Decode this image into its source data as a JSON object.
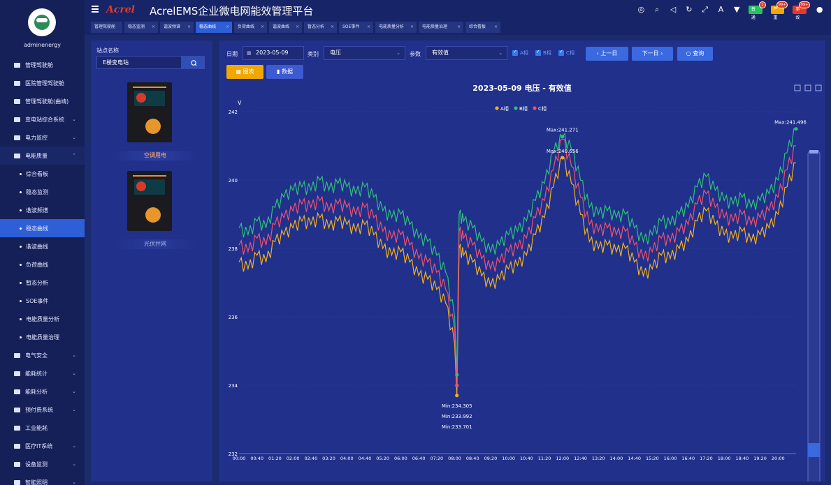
{
  "app": {
    "logo": "Acrel",
    "title": "AcrelEMS企业微电网能效管理平台"
  },
  "user": {
    "name": "adminenergy"
  },
  "topbar": {
    "icons": [
      "help-icon",
      "search-icon",
      "volume-icon",
      "refresh-icon",
      "fullscreen-icon",
      "font-icon",
      "shirt-icon"
    ],
    "badges": [
      {
        "label": "普通",
        "count": "2",
        "color": "#22c55e"
      },
      {
        "label": "严重",
        "count": "99+",
        "color": "#f0a800"
      },
      {
        "label": "事故",
        "count": "99+",
        "color": "#e23a2a"
      }
    ]
  },
  "menu": [
    {
      "label": "管理驾驶舱",
      "type": "item"
    },
    {
      "label": "医院管理驾驶舱",
      "type": "item"
    },
    {
      "label": "管理驾驶舱(曲靖)",
      "type": "item"
    },
    {
      "label": "变电站综合系统",
      "type": "item",
      "arrow": "⌄"
    },
    {
      "label": "电力监控",
      "type": "item",
      "arrow": "⌄"
    },
    {
      "label": "电能质量",
      "type": "group",
      "arrow": "⌃"
    },
    {
      "label": "综合看板",
      "type": "sub"
    },
    {
      "label": "稳态监测",
      "type": "sub"
    },
    {
      "label": "谐波频谱",
      "type": "sub"
    },
    {
      "label": "稳态曲线",
      "type": "sub",
      "active": true
    },
    {
      "label": "谐波曲线",
      "type": "sub"
    },
    {
      "label": "负荷曲线",
      "type": "sub"
    },
    {
      "label": "暂态分析",
      "type": "sub"
    },
    {
      "label": "SOE事件",
      "type": "sub"
    },
    {
      "label": "电能质量分析",
      "type": "sub"
    },
    {
      "label": "电能质量治理",
      "type": "sub"
    },
    {
      "label": "电气安全",
      "type": "item",
      "arrow": "⌄"
    },
    {
      "label": "能耗统计",
      "type": "item",
      "arrow": "⌄"
    },
    {
      "label": "能耗分析",
      "type": "item",
      "arrow": "⌄"
    },
    {
      "label": "预付费系统",
      "type": "item",
      "arrow": "⌄"
    },
    {
      "label": "工业能耗",
      "type": "item"
    },
    {
      "label": "医疗IT系统",
      "type": "item",
      "arrow": "⌄"
    },
    {
      "label": "设备监测",
      "type": "item",
      "arrow": "⌄"
    },
    {
      "label": "智能照明",
      "type": "item",
      "arrow": "⌄"
    }
  ],
  "tabs": [
    {
      "label": "管理驾驶舱",
      "closable": false
    },
    {
      "label": "稳态监测",
      "closable": true
    },
    {
      "label": "谐波频谱",
      "closable": true
    },
    {
      "label": "稳态曲线",
      "closable": true,
      "active": true
    },
    {
      "label": "负荷曲线",
      "closable": true
    },
    {
      "label": "谐波曲线",
      "closable": true
    },
    {
      "label": "暂态分析",
      "closable": true
    },
    {
      "label": "SOE事件",
      "closable": true
    },
    {
      "label": "电能质量分析",
      "closable": true
    },
    {
      "label": "电能质量治理",
      "closable": true
    },
    {
      "label": "综合看板",
      "closable": true
    }
  ],
  "station": {
    "label": "站点名称",
    "value": "E楼变电站",
    "devices": [
      {
        "name": "空调用电",
        "selected": true
      },
      {
        "name": "光伏并网",
        "selected": false
      }
    ]
  },
  "filters": {
    "date_label": "日期",
    "date_value": "2023-05-09",
    "category_label": "类别",
    "category_value": "电压",
    "param_label": "参数",
    "param_value": "有效值",
    "phases": [
      "A相",
      "B相",
      "C相"
    ],
    "prev": "上一日",
    "next": "下一日",
    "query": "查询",
    "view_chart": "图表",
    "view_data": "数据"
  },
  "chart_data": {
    "type": "line",
    "title": "2023-05-09  电压 - 有效值",
    "ylabel": "V",
    "ylim": [
      232,
      242
    ],
    "yticks": [
      232,
      234,
      236,
      238,
      240,
      242
    ],
    "xticks": [
      "00:00",
      "00:40",
      "01:20",
      "02:00",
      "02:40",
      "03:20",
      "04:00",
      "04:40",
      "05:20",
      "06:00",
      "06:40",
      "07:20",
      "08:00",
      "08:40",
      "09:20",
      "10:00",
      "10:40",
      "11:20",
      "12:00",
      "12:40",
      "13:20",
      "14:00",
      "14:40",
      "15:20",
      "16:00",
      "16:40",
      "17:20",
      "18:00",
      "18:40",
      "19:20",
      "20:00"
    ],
    "legend_position": "top-center",
    "series": [
      {
        "name": "A相",
        "color": "#f0b020",
        "x": [
          0,
          20,
          40,
          60,
          80,
          100,
          120,
          140,
          160,
          180,
          200,
          220,
          240,
          260,
          280,
          300,
          320,
          340,
          360,
          380,
          400,
          420,
          440,
          460,
          480,
          485,
          490,
          500,
          520,
          540,
          560,
          580,
          600,
          620,
          640,
          660,
          680,
          700,
          720,
          740,
          760,
          780,
          800,
          820,
          840,
          860,
          880,
          900,
          920,
          940,
          960,
          980,
          1000,
          1020,
          1040,
          1060,
          1080,
          1100,
          1120,
          1140,
          1160,
          1180,
          1200,
          1220,
          1240
        ],
        "values": [
          237.6,
          237.4,
          237.8,
          237.6,
          238.2,
          238.4,
          238.6,
          238.8,
          238.7,
          238.9,
          238.6,
          238.8,
          238.7,
          238.5,
          238.7,
          238.4,
          238.0,
          237.8,
          237.9,
          237.6,
          237.2,
          237.1,
          236.8,
          236.4,
          235.2,
          233.701,
          238.0,
          237.8,
          237.6,
          237.2,
          236.9,
          237.1,
          237.4,
          237.5,
          237.8,
          238.4,
          238.9,
          239.8,
          240.656,
          239.9,
          239.0,
          238.2,
          238.0,
          238.1,
          237.9,
          238.0,
          237.6,
          237.2,
          237.4,
          237.8,
          237.7,
          238.0,
          238.2,
          238.8,
          239.1,
          238.7,
          238.4,
          238.3,
          238.5,
          238.2,
          238.4,
          238.6,
          239.0,
          239.8,
          240.5
        ]
      },
      {
        "name": "B相",
        "color": "#2ec07a",
        "x": [
          0,
          20,
          40,
          60,
          80,
          100,
          120,
          140,
          160,
          180,
          200,
          220,
          240,
          260,
          280,
          300,
          320,
          340,
          360,
          380,
          400,
          420,
          440,
          460,
          480,
          485,
          490,
          500,
          520,
          540,
          560,
          580,
          600,
          620,
          640,
          660,
          680,
          700,
          720,
          740,
          760,
          780,
          800,
          820,
          840,
          860,
          880,
          900,
          920,
          940,
          960,
          980,
          1000,
          1020,
          1040,
          1060,
          1080,
          1100,
          1120,
          1140,
          1160,
          1180,
          1200,
          1220,
          1240
        ],
        "values": [
          238.6,
          238.4,
          238.8,
          238.6,
          239.2,
          239.5,
          239.7,
          239.8,
          239.7,
          240.0,
          239.7,
          239.9,
          239.8,
          239.6,
          239.8,
          239.5,
          239.1,
          238.9,
          239.0,
          238.7,
          238.3,
          238.2,
          237.8,
          237.3,
          236.0,
          234.305,
          239.0,
          238.8,
          238.6,
          238.2,
          237.9,
          238.1,
          238.4,
          238.5,
          238.8,
          239.4,
          239.9,
          240.8,
          241.271,
          240.9,
          240.0,
          239.2,
          239.0,
          239.1,
          238.9,
          239.0,
          238.6,
          238.2,
          238.4,
          238.8,
          238.7,
          239.0,
          239.2,
          239.8,
          240.1,
          239.7,
          239.4,
          239.3,
          239.5,
          239.2,
          239.4,
          239.6,
          240.0,
          240.8,
          241.496
        ]
      },
      {
        "name": "C相",
        "color": "#f0506e",
        "x": [
          0,
          20,
          40,
          60,
          80,
          100,
          120,
          140,
          160,
          180,
          200,
          220,
          240,
          260,
          280,
          300,
          320,
          340,
          360,
          380,
          400,
          420,
          440,
          460,
          480,
          485,
          490,
          500,
          520,
          540,
          560,
          580,
          600,
          620,
          640,
          660,
          680,
          700,
          720,
          740,
          760,
          780,
          800,
          820,
          840,
          860,
          880,
          900,
          920,
          940,
          960,
          980,
          1000,
          1020,
          1040,
          1060,
          1080,
          1100,
          1120,
          1140,
          1160,
          1180,
          1200,
          1220,
          1240
        ],
        "values": [
          238.1,
          237.9,
          238.3,
          238.1,
          238.7,
          238.9,
          239.1,
          239.3,
          239.2,
          239.4,
          239.1,
          239.3,
          239.2,
          239.0,
          239.2,
          238.9,
          238.5,
          238.3,
          238.4,
          238.1,
          237.7,
          237.6,
          237.3,
          236.8,
          235.6,
          233.992,
          238.5,
          238.3,
          238.1,
          237.7,
          237.4,
          237.6,
          237.9,
          238.0,
          238.3,
          238.9,
          239.4,
          240.3,
          241.2,
          240.4,
          239.5,
          238.7,
          238.5,
          238.6,
          238.4,
          238.5,
          238.1,
          237.7,
          237.9,
          238.3,
          238.2,
          238.5,
          238.7,
          239.3,
          239.6,
          239.2,
          238.9,
          238.8,
          239.0,
          238.7,
          238.9,
          239.1,
          239.5,
          240.3,
          241.0
        ]
      }
    ],
    "markers": [
      {
        "label": "Max:241.271",
        "series": "B相",
        "x": 720,
        "y": 241.271
      },
      {
        "label": "Max:240.656",
        "series": "A相",
        "x": 720,
        "y": 240.656
      },
      {
        "label": "Max:241.496",
        "series": "B相",
        "x": 1240,
        "y": 241.496
      },
      {
        "label": "Min:234.305",
        "series": "B相",
        "x": 485,
        "y": 234.305
      },
      {
        "label": "Min:233.992",
        "series": "C相",
        "x": 485,
        "y": 233.992
      },
      {
        "label": "Min:233.701",
        "series": "A相",
        "x": 485,
        "y": 233.701
      }
    ],
    "x_range_minutes": [
      0,
      1240
    ]
  }
}
